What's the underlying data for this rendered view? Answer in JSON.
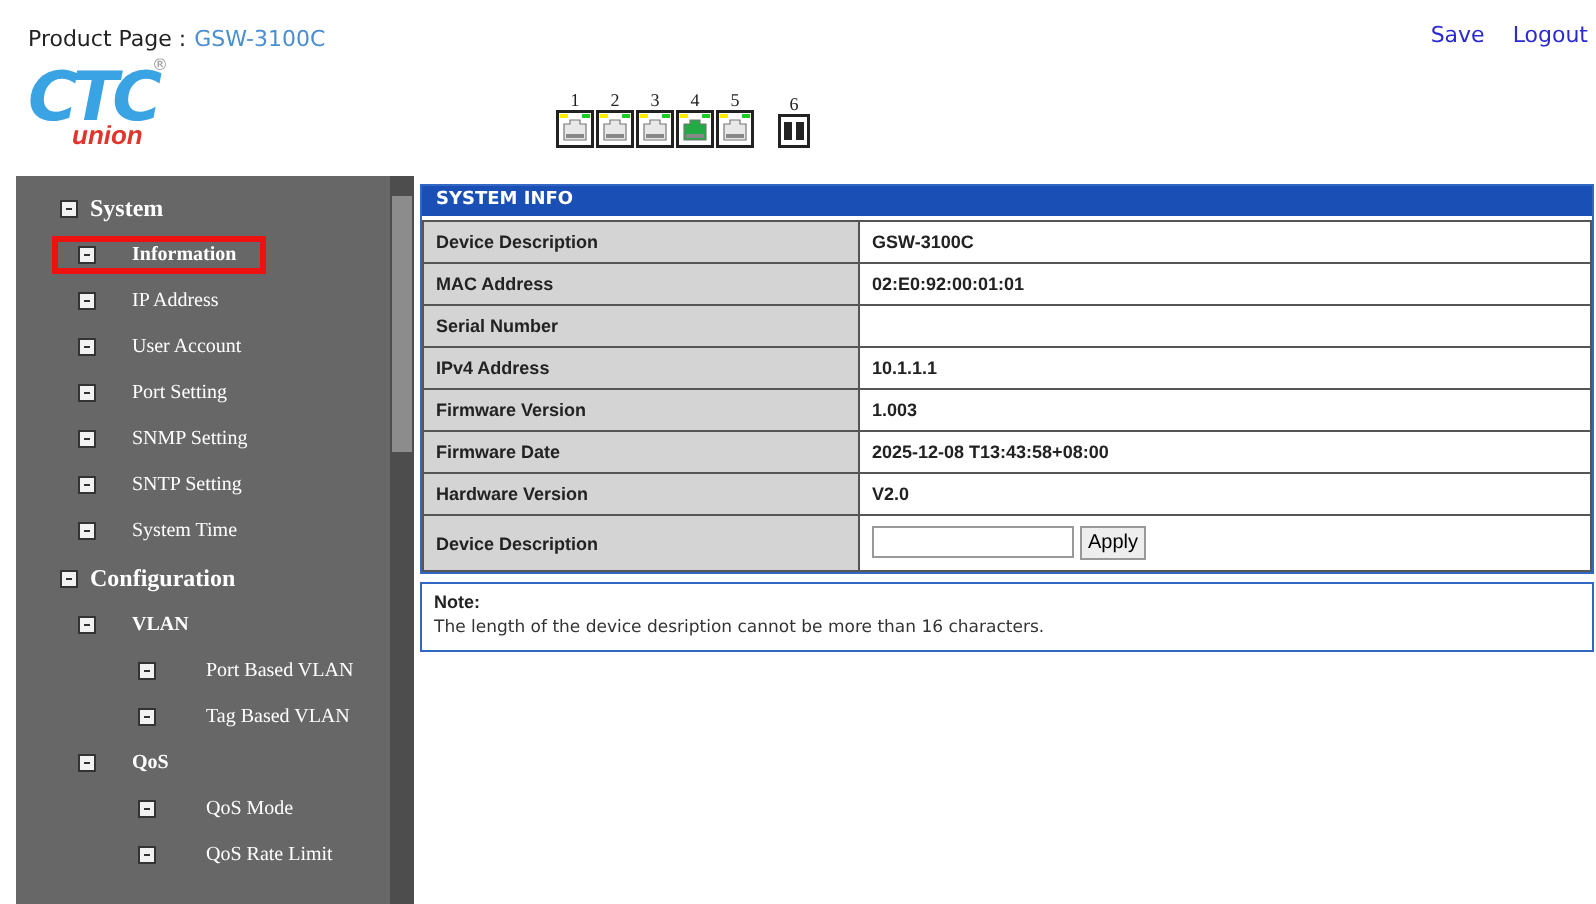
{
  "header": {
    "label": "Product Page :",
    "product": "GSW-3100C",
    "links": [
      {
        "label": "Save"
      },
      {
        "label": "Logout"
      }
    ]
  },
  "logo": {
    "main": "CTC",
    "sub": "union",
    "mark": "®"
  },
  "ports": [
    {
      "label": "1",
      "kind": "rj45",
      "link": false
    },
    {
      "label": "2",
      "kind": "rj45",
      "link": false
    },
    {
      "label": "3",
      "kind": "rj45",
      "link": false
    },
    {
      "label": "4",
      "kind": "rj45",
      "link": true
    },
    {
      "label": "5",
      "kind": "rj45",
      "link": false
    },
    {
      "label": "6",
      "kind": "fiber",
      "link": false
    }
  ],
  "sidebar": {
    "items": [
      {
        "label": "System",
        "expanded": true,
        "selected": false,
        "children": [
          {
            "label": "Information",
            "selected": true
          },
          {
            "label": "IP Address",
            "selected": false
          },
          {
            "label": "User Account",
            "selected": false
          },
          {
            "label": "Port Setting",
            "selected": false
          },
          {
            "label": "SNMP Setting",
            "selected": false
          },
          {
            "label": "SNTP Setting",
            "selected": false
          },
          {
            "label": "System Time",
            "selected": false
          }
        ]
      },
      {
        "label": "Configuration",
        "expanded": true,
        "selected": false,
        "children": [
          {
            "label": "VLAN",
            "expanded": true,
            "selected": false,
            "children": [
              {
                "label": "Port Based VLAN",
                "selected": false
              },
              {
                "label": "Tag Based VLAN",
                "selected": false
              }
            ]
          },
          {
            "label": "QoS",
            "expanded": true,
            "selected": false,
            "children": [
              {
                "label": "QoS Mode",
                "selected": false
              },
              {
                "label": "QoS Rate Limit",
                "selected": false
              }
            ]
          }
        ]
      }
    ]
  },
  "panel": {
    "title": "SYSTEM INFO",
    "rows": [
      {
        "label": "Device Description",
        "value": "GSW-3100C"
      },
      {
        "label": "MAC Address",
        "value": "02:E0:92:00:01:01"
      },
      {
        "label": "Serial Number"
      },
      {
        "label": "IPv4 Address",
        "value": "10.1.1.1"
      },
      {
        "label": "Firmware Version",
        "value": "1.003"
      },
      {
        "label": "Firmware Date",
        "value": "2025-12-08 T13:43:58+08:00"
      },
      {
        "label": "Hardware Version",
        "value": "V2.0"
      },
      {
        "label": "Device Description",
        "kind": "input",
        "button": "Apply"
      }
    ],
    "note": {
      "title": "Note:",
      "text": "The length of the device desription cannot be more than 16 characters."
    }
  }
}
